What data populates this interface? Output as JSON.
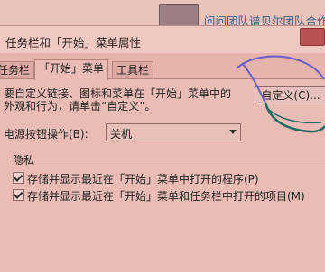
{
  "top_bar": {
    "link_text": "问问团队谱贝尔团队合作"
  },
  "dialog": {
    "title": "任务栏和「开始」菜单属性",
    "tabs": [
      {
        "label": "任务栏"
      },
      {
        "label": "「开始」菜单",
        "active": true
      },
      {
        "label": "工具栏"
      }
    ],
    "start_menu_tab": {
      "description": "要自定义链接、图标和菜单在「开始」菜单中的\n外观和行为，请单击“自定义”。",
      "customize_button": "自定义(C)...",
      "power_button_label": "电源按钮操作(B):",
      "power_button_value": "关机",
      "privacy_group_title": "隐私",
      "privacy_options": [
        {
          "label": "存储并显示最近在「开始」菜单中打开的程序(P)",
          "checked": true
        },
        {
          "label": "存储并显示最近在「开始」菜单和任务栏中打开的项目(M)",
          "checked": true
        }
      ]
    }
  },
  "colors": {
    "background": "#d8a6a0",
    "dialog_body": "#ebbcb6",
    "annotation_purple": "#6a5ec8",
    "annotation_teal": "#1a6b63",
    "link": "#3d5f86",
    "close_button": "#b85151"
  }
}
